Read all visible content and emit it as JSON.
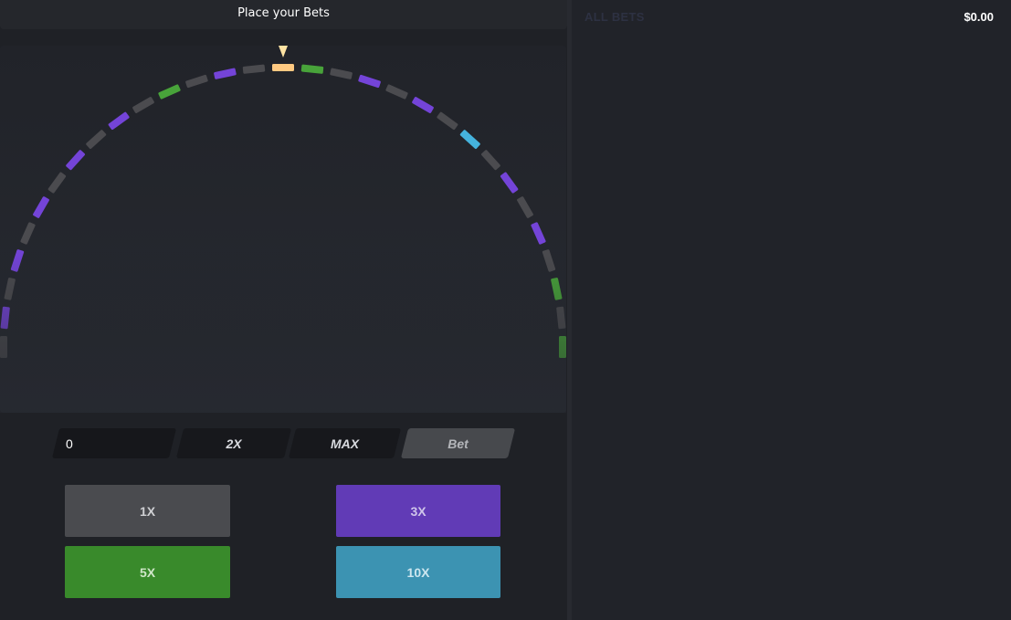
{
  "header": {
    "title": "Place your Bets"
  },
  "wheel": {
    "pointer_color": "#ffe3a3",
    "segments": [
      "grey",
      "purple",
      "grey",
      "purple",
      "grey",
      "purple",
      "grey",
      "purple",
      "grey",
      "purple",
      "grey",
      "green",
      "grey",
      "purple",
      "grey",
      "gold",
      "green",
      "grey",
      "purple",
      "grey",
      "purple",
      "grey",
      "blue",
      "grey",
      "purple",
      "grey",
      "purple",
      "grey",
      "green",
      "grey",
      "green"
    ],
    "colors": {
      "grey": "#4b4b4f",
      "purple": "#7444d8",
      "green": "#48a33a",
      "gold": "#ffc981",
      "blue": "#45b3dd"
    }
  },
  "controls": {
    "amount_value": "0",
    "double_label": "2X",
    "max_label": "MAX",
    "bet_label": "Bet"
  },
  "multipliers": [
    {
      "label": "1X",
      "color": "#4a4b4f",
      "text_color": "#cfd0d3"
    },
    {
      "label": "3X",
      "color": "#613bb6",
      "text_color": "#cfc5ea"
    },
    {
      "label": "5X",
      "color": "#398a2b",
      "text_color": "#cfe6c8"
    },
    {
      "label": "10X",
      "color": "#3c93b2",
      "text_color": "#cde6ef"
    }
  ],
  "right_panel": {
    "all_bets_label": "ALL BETS",
    "total": "$0.00"
  }
}
